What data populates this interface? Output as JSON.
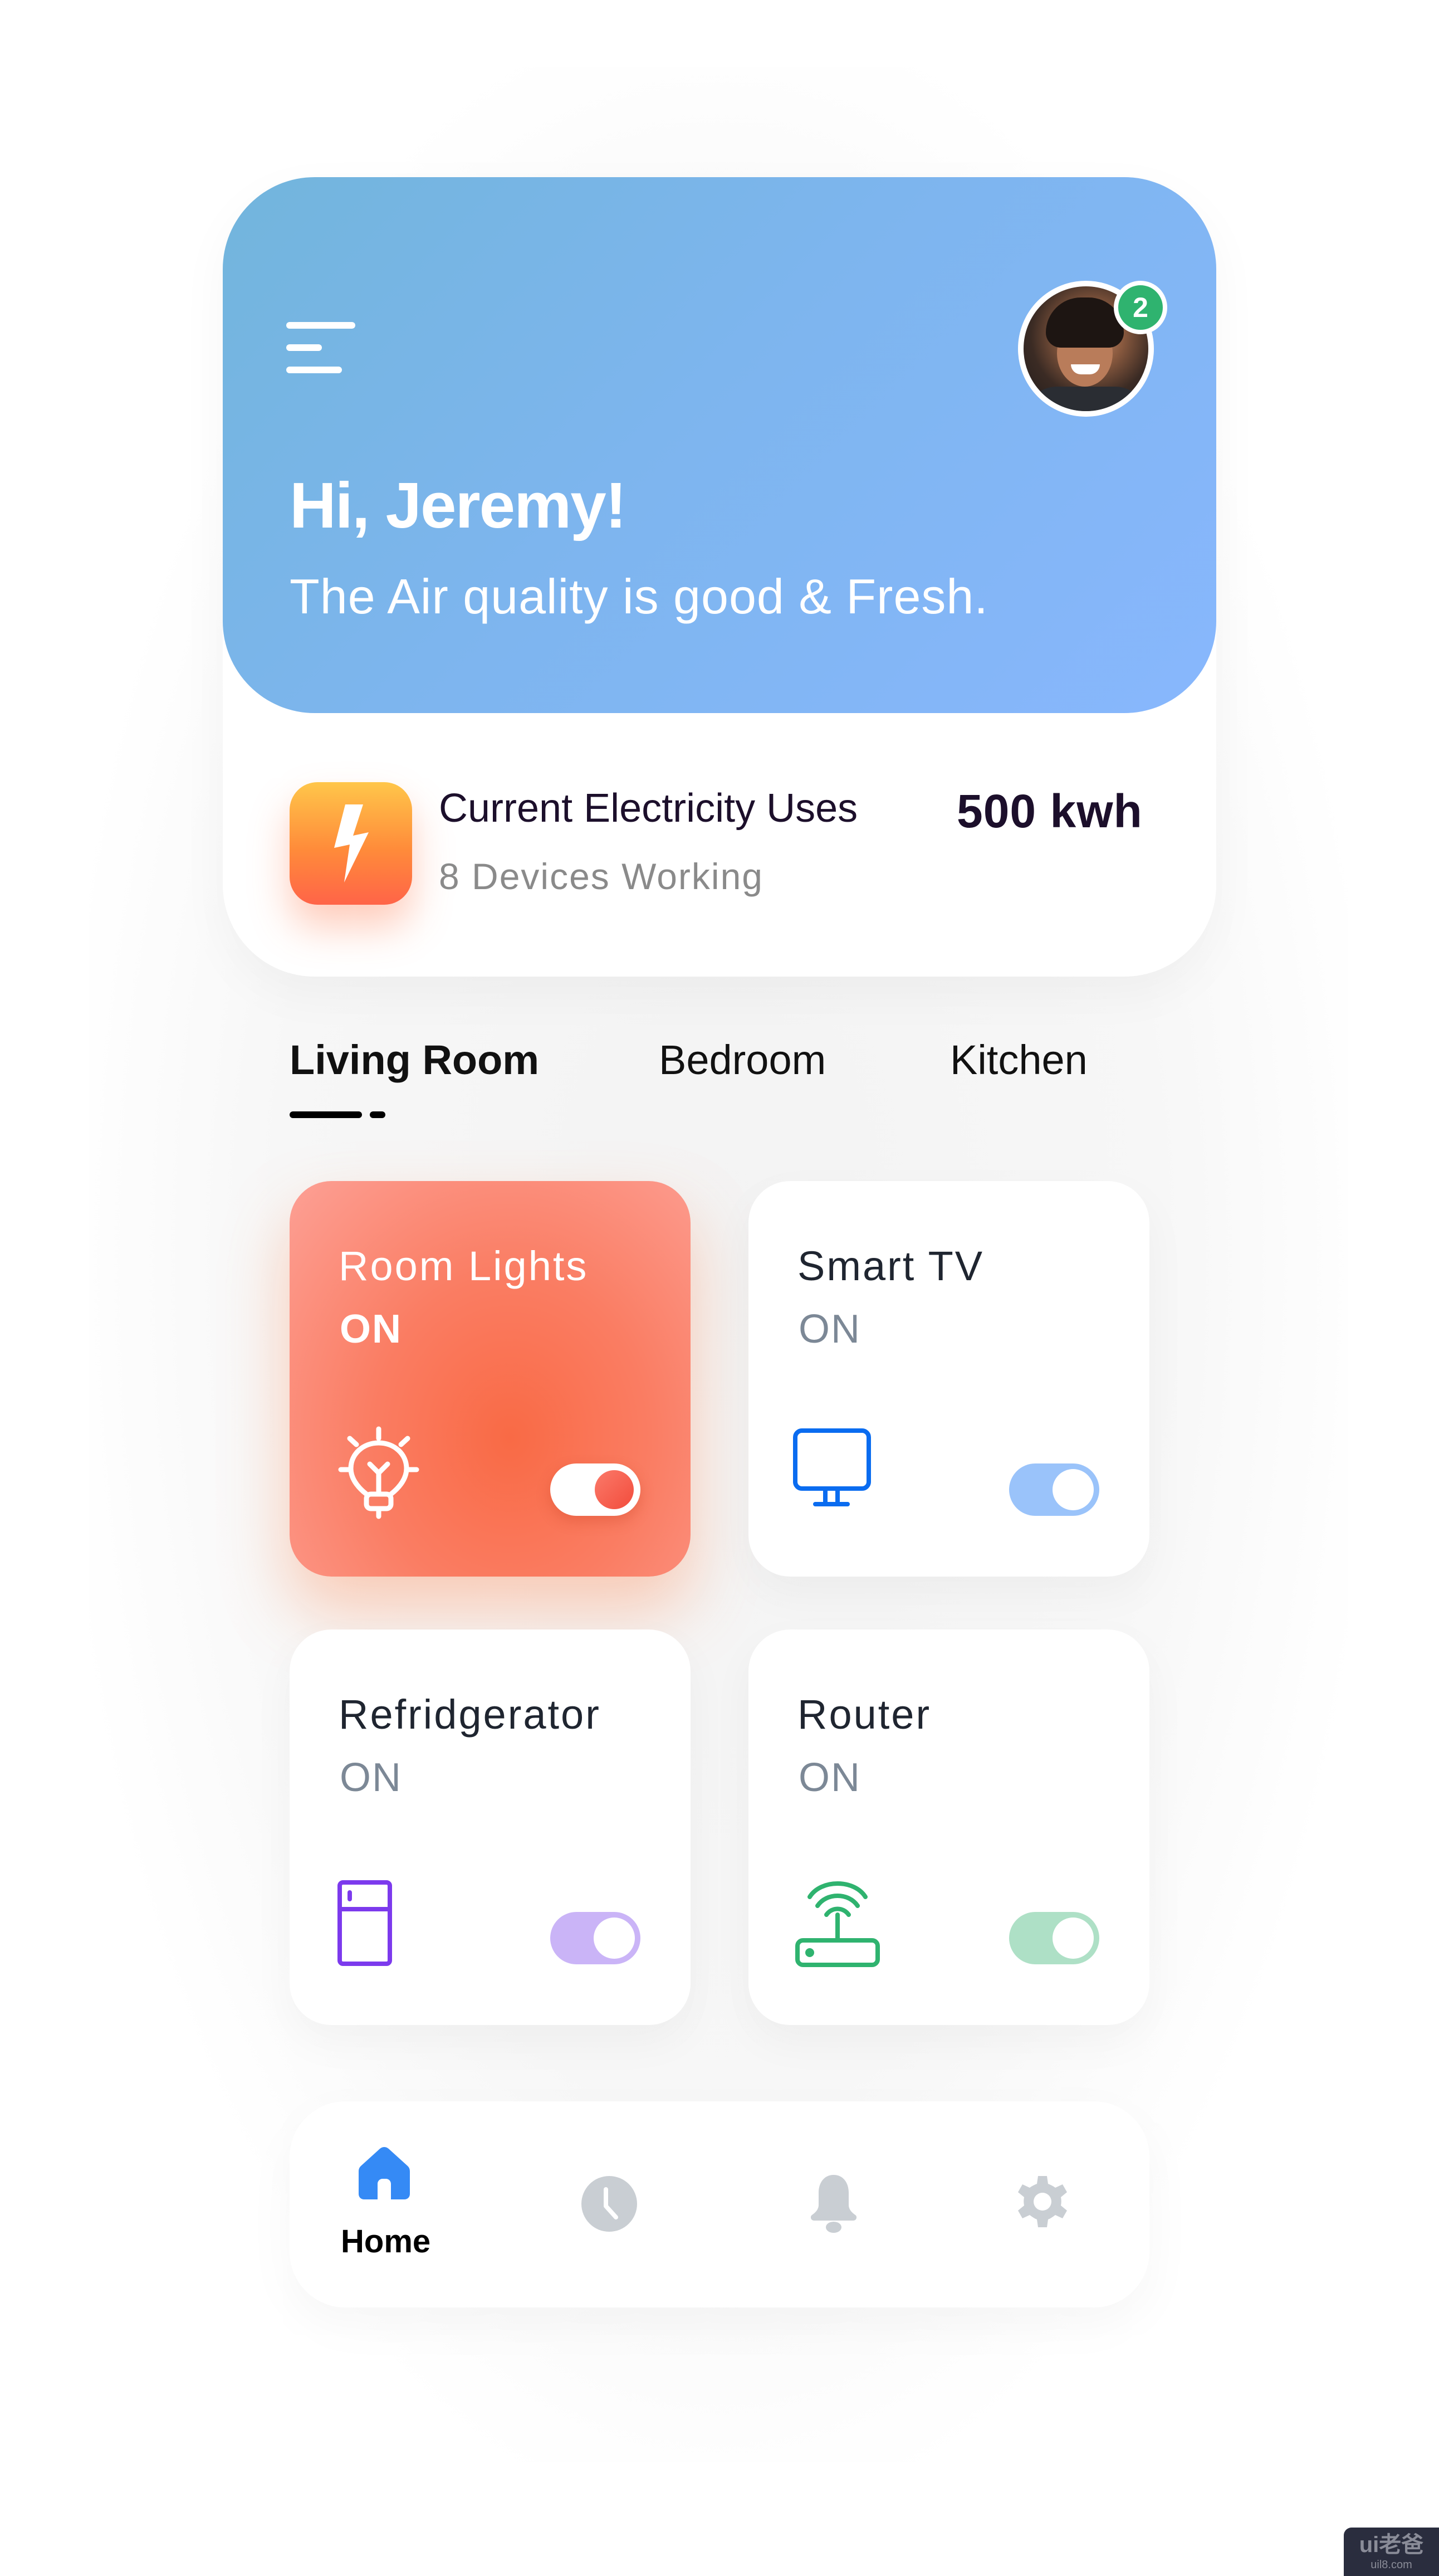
{
  "header": {
    "greeting": "Hi, Jeremy!",
    "subtitle": "The Air quality is good & Fresh.",
    "notification_count": "2",
    "avatar_alt": "Jeremy"
  },
  "electricity": {
    "title": "Current Electricity Uses",
    "devices_working": "8 Devices Working",
    "usage": "500 kwh"
  },
  "tabs": [
    {
      "label": "Living Room",
      "active": true
    },
    {
      "label": "Bedroom",
      "active": false
    },
    {
      "label": "Kitchen",
      "active": false
    }
  ],
  "devices": [
    {
      "name": "Room Lights",
      "status": "ON",
      "icon": "lightbulb-icon",
      "on": true,
      "color": "#f96a45",
      "active": true
    },
    {
      "name": "Smart TV",
      "status": "ON",
      "icon": "monitor-icon",
      "on": true,
      "color": "#0a6cf0",
      "toggle_color": "#9ac3fa"
    },
    {
      "name": "Refridgerator",
      "status": "ON",
      "icon": "fridge-icon",
      "on": true,
      "color": "#7c3aed",
      "toggle_color": "#cab4f7"
    },
    {
      "name": "Router",
      "status": "ON",
      "icon": "router-icon",
      "on": true,
      "color": "#2fb36f",
      "toggle_color": "#aee0c6"
    }
  ],
  "bottom_nav": [
    {
      "label": "Home",
      "icon": "home-icon",
      "active": true,
      "color": "#358af5"
    },
    {
      "label": "",
      "icon": "clock-icon",
      "active": false,
      "color": "#c9ced3"
    },
    {
      "label": "",
      "icon": "bell-icon",
      "active": false,
      "color": "#c9ced3"
    },
    {
      "label": "",
      "icon": "gear-icon",
      "active": false,
      "color": "#c9ced3"
    }
  ],
  "watermark": {
    "logo": "ui老爸",
    "url": "uil8.com"
  }
}
